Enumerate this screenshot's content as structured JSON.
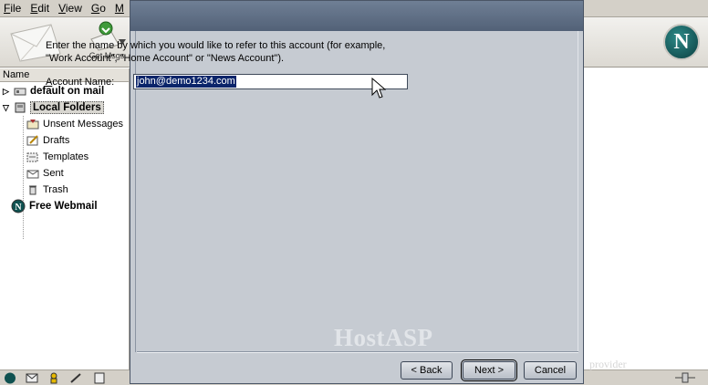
{
  "menu": [
    "File",
    "Edit",
    "View",
    "Go",
    "M"
  ],
  "menu_accel": [
    "F",
    "E",
    "V",
    "G",
    "M"
  ],
  "toolbar": {
    "get_msgs_label": "Get Msgs"
  },
  "folder_pane": {
    "column_header": "Name",
    "accounts": [
      {
        "label": "default on mail",
        "icon": "server-icon",
        "expanded": false
      },
      {
        "label": "Local Folders",
        "icon": "computer-icon",
        "expanded": true,
        "selected": true
      },
      {
        "label": "Free Webmail",
        "icon": "netscape-webmail-icon"
      }
    ],
    "folders": [
      {
        "label": "Unsent Messages",
        "icon": "outbox-icon"
      },
      {
        "label": "Drafts",
        "icon": "drafts-icon"
      },
      {
        "label": "Templates",
        "icon": "templates-icon"
      },
      {
        "label": "Sent",
        "icon": "sent-icon"
      },
      {
        "label": "Trash",
        "icon": "trash-icon"
      }
    ]
  },
  "dialog": {
    "instruction": "Enter the name by which you would like to refer to this account (for example, \"Work Account\", \"Home Account\" or \"News Account\").",
    "account_name_label": "Account Name:",
    "account_name_accel": "A",
    "account_name_value": "john@demo1234.com",
    "buttons": {
      "back": "< Back",
      "next": "Next >",
      "cancel": "Cancel"
    }
  },
  "watermark": {
    "brand": "HostASP",
    "tagline": "provider"
  },
  "colors": {
    "dialog_bg": "#c6cbd2",
    "titlebar": "#526177",
    "selection": "#0a246a"
  }
}
